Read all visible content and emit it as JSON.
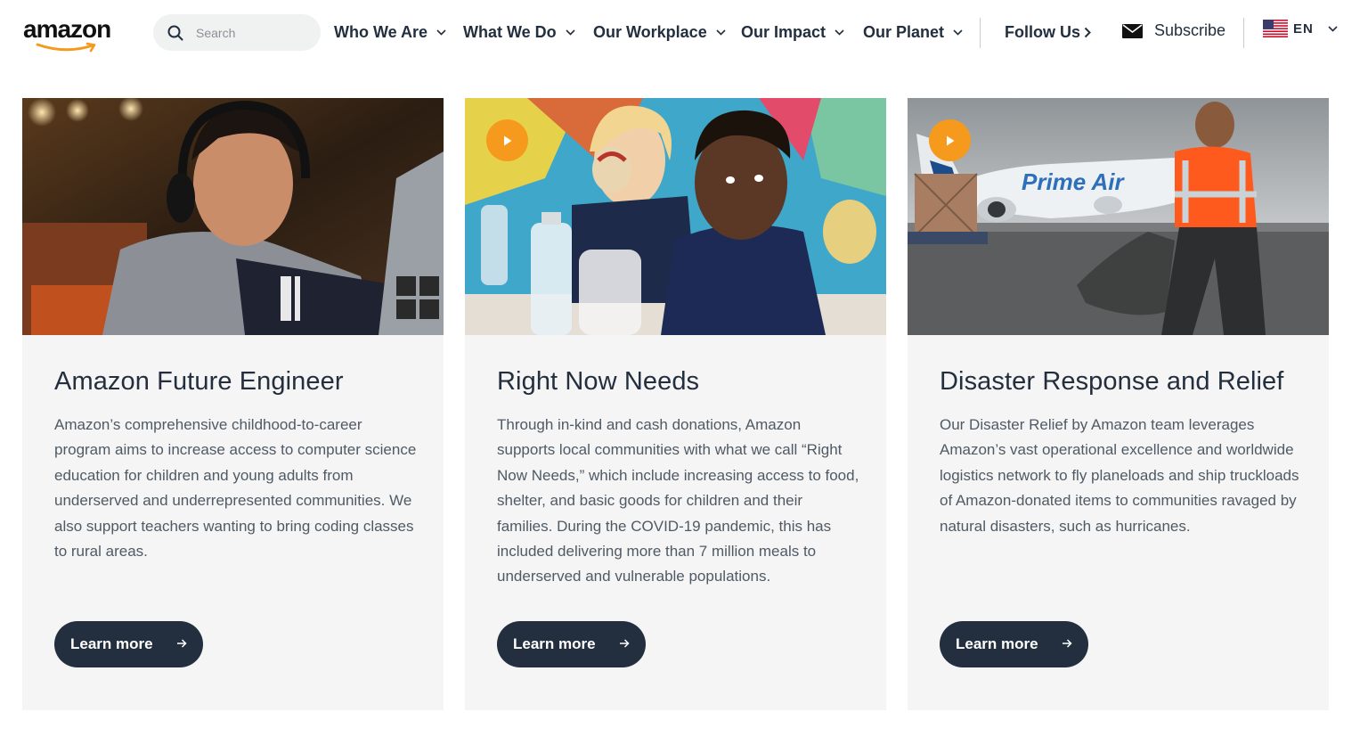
{
  "header": {
    "logo_text": "amazon",
    "search": {
      "placeholder": "Search",
      "value": ""
    },
    "nav": [
      {
        "label": "Who We Are"
      },
      {
        "label": "What We Do"
      },
      {
        "label": "Our Workplace"
      },
      {
        "label": "Our Impact"
      },
      {
        "label": "Our Planet"
      }
    ],
    "follow_label": "Follow Us",
    "subscribe_label": "Subscribe",
    "language_code": "EN"
  },
  "cards": [
    {
      "title": "Amazon Future Engineer",
      "body": "Amazon’s comprehensive childhood-to-career program aims to increase access to computer science education for children and young adults from underserved and underrepresented communities. We also support teachers wanting to bring coding classes to rural areas.",
      "button_label": "Learn more",
      "has_video": false
    },
    {
      "title": "Right Now Needs",
      "body": "Through in-kind and cash donations, Amazon supports local communities with what we call “Right Now Needs,” which include increasing access to food, shelter, and basic goods for children and their families. During the COVID-19 pandemic, this has included delivering more than 7 million meals to underserved and vulnerable populations.",
      "button_label": "Learn more",
      "has_video": true
    },
    {
      "title": "Disaster Response and Relief",
      "body": "Our Disaster Relief by Amazon team leverages Amazon’s vast operational excellence and worldwide logistics network to fly planeloads and ship truckloads of Amazon-donated items to communities ravaged by natural disasters, such as hurricanes.",
      "button_label": "Learn more",
      "has_video": true,
      "image_text": "Prime Air"
    }
  ],
  "colors": {
    "navy": "#232f3e",
    "amazon_orange": "#f59a1c",
    "card_bg": "#f5f5f5",
    "body_text": "#4f5a65"
  },
  "icons": [
    "search-icon",
    "chevron-down-icon",
    "chevron-right-icon",
    "mail-icon",
    "us-flag-icon",
    "play-icon",
    "arrow-right-icon"
  ]
}
